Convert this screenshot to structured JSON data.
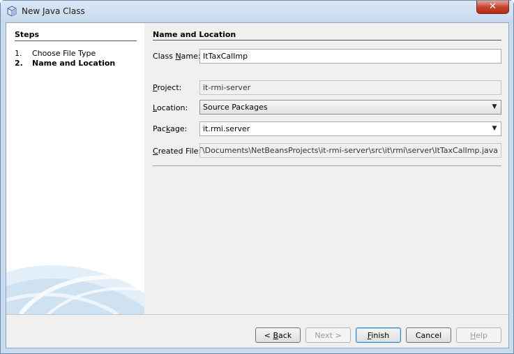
{
  "window": {
    "title": "New Java Class",
    "close_glyph": "✕",
    "icon": "java-class-icon"
  },
  "steps": {
    "title": "Steps",
    "items": [
      {
        "num": "1.",
        "label": "Choose File Type",
        "active": false
      },
      {
        "num": "2.",
        "label": "Name and Location",
        "active": true
      }
    ]
  },
  "form": {
    "title": "Name and Location",
    "class_name": {
      "label": "Class Name:",
      "value": "ItTaxCalImp"
    },
    "project": {
      "label": "Project:",
      "value": "it-rmi-server"
    },
    "location": {
      "label": "Location:",
      "value": "Source Packages"
    },
    "package": {
      "label": "Package:",
      "value": "it.rmi.server"
    },
    "created_file": {
      "label": "Created File:",
      "value": "SHMAN-LT\\Documents\\NetBeansProjects\\it-rmi-server\\src\\it\\rmi\\server\\ItTaxCalImp.java"
    }
  },
  "buttons": {
    "back": "< Back",
    "next": "Next >",
    "finish": "Finish",
    "cancel": "Cancel",
    "help": "Help"
  },
  "colors": {
    "frame": "#c9dcef",
    "close": "#c74532",
    "default_button_border": "#3c7fb1"
  }
}
